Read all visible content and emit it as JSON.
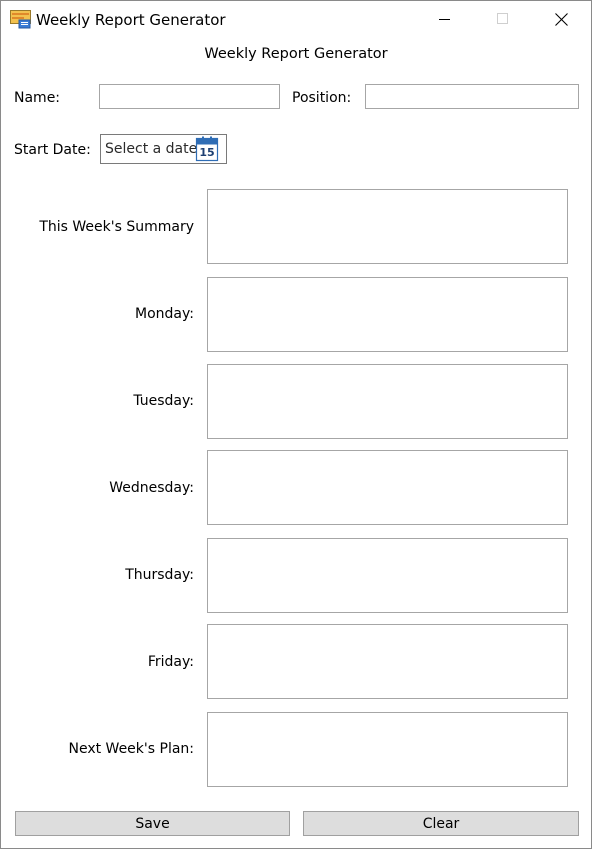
{
  "window": {
    "title": "Weekly Report Generator",
    "icon": "app-window-icon",
    "controls": {
      "minimize": "minimize-icon",
      "maximize": "maximize-icon",
      "close": "close-icon"
    }
  },
  "header": {
    "title": "Weekly Report Generator"
  },
  "form": {
    "name_label": "Name:",
    "name_value": "",
    "position_label": "Position:",
    "position_value": "",
    "start_date_label": "Start Date:",
    "date_placeholder": "Select a date",
    "calendar_day": "15"
  },
  "sections": [
    {
      "label": "This Week's Summary",
      "value": ""
    },
    {
      "label": "Monday:",
      "value": ""
    },
    {
      "label": "Tuesday:",
      "value": ""
    },
    {
      "label": "Wednesday:",
      "value": ""
    },
    {
      "label": "Thursday:",
      "value": ""
    },
    {
      "label": "Friday:",
      "value": ""
    },
    {
      "label": "Next Week's Plan:",
      "value": ""
    }
  ],
  "buttons": {
    "save": "Save",
    "clear": "Clear"
  },
  "colors": {
    "button_bg": "#dddddd",
    "border": "#a6a6a6",
    "calendar_blue": "#2f6db5"
  }
}
